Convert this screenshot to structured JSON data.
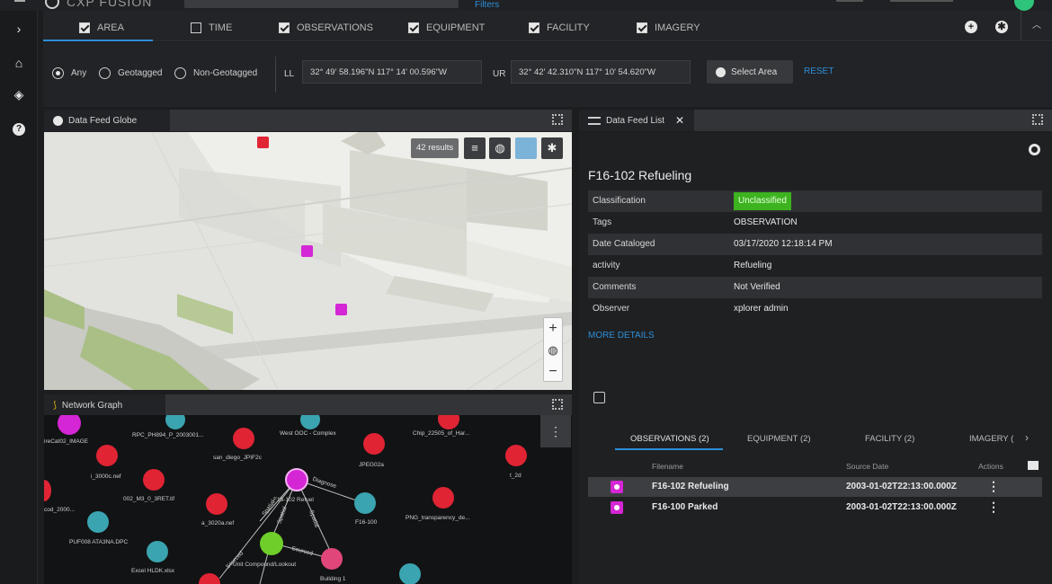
{
  "topbar": {
    "brand": "CXP FUSION",
    "filters_link": "Filters"
  },
  "rail": {
    "expand": "›",
    "home": "⌂",
    "layers": "◈",
    "help": "?"
  },
  "filter_tabs": [
    {
      "label": "AREA",
      "checked": true
    },
    {
      "label": "TIME",
      "checked": false
    },
    {
      "label": "OBSERVATIONS",
      "checked": true
    },
    {
      "label": "EQUIPMENT",
      "checked": true
    },
    {
      "label": "FACILITY",
      "checked": true
    },
    {
      "label": "IMAGERY",
      "checked": true
    }
  ],
  "area": {
    "options": [
      "Any",
      "Geotagged",
      "Non-Geotagged"
    ],
    "selected": "Any",
    "ll_label": "LL",
    "ll_value": "32° 49' 58.196\"N 117° 14' 00.596\"W",
    "ur_label": "UR",
    "ur_value": "32° 42' 42.310\"N 117° 10' 54.620\"W",
    "select_area": "Select Area",
    "reset": "RESET"
  },
  "globe_panel": {
    "title": "Data Feed Globe",
    "results": "42 results"
  },
  "graph_panel": {
    "title": "Network Graph",
    "nodes": [
      {
        "label": "ireCat02_IMAGE",
        "kind": "target",
        "color": "#d426d4"
      },
      {
        "label": "RPC_PH894_P_2003001...",
        "kind": "doc",
        "color": "#3aa4b0"
      },
      {
        "label": "West OOC - Complex",
        "kind": "doc",
        "color": "#3aa4b0"
      },
      {
        "label": "Chip_22505_of_Har...",
        "kind": "camera",
        "color": "#e02434"
      },
      {
        "label": "i_3000c.nef",
        "kind": "camera",
        "color": "#e02434"
      },
      {
        "label": "san_diego_JPIF2c",
        "kind": "camera",
        "color": "#e02434"
      },
      {
        "label": "JPEG02a",
        "kind": "camera",
        "color": "#e02434"
      },
      {
        "label": "t_2d",
        "kind": "camera",
        "color": "#e02434"
      },
      {
        "label": "002_M3_0_3RET.tif",
        "kind": "camera",
        "color": "#e02434"
      },
      {
        "label": "F16-102 Refuel",
        "kind": "target",
        "color": "#d426d4"
      },
      {
        "label": "a_3020a.nef",
        "kind": "camera",
        "color": "#e02434"
      },
      {
        "label": "F16-100",
        "kind": "plane",
        "color": "#3aa4b0"
      },
      {
        "label": "PNG_transparency_de...",
        "kind": "camera",
        "color": "#e02434"
      },
      {
        "label": "cod_2000...",
        "kind": "camera",
        "color": "#e02434"
      },
      {
        "label": "PUF008 ATA3NA.DPC",
        "kind": "doc",
        "color": "#3aa4b0"
      },
      {
        "label": "Excel HLDK.xlsx",
        "kind": "doc",
        "color": "#3aa4b0"
      },
      {
        "label": "Unit Compound/Lookout",
        "kind": "eye",
        "color": "#6fce2a"
      },
      {
        "label": "Building 1",
        "kind": "building",
        "color": "#e0467a"
      }
    ],
    "edges": [
      "Diagnose",
      "Spatial",
      "Spatial",
      "Spatial",
      "Sourced",
      "Sourced"
    ]
  },
  "list_panel": {
    "title": "Data Feed List",
    "record_title": "F16-102 Refueling",
    "attributes": [
      {
        "key": "Classification",
        "value": "Unclassified",
        "badge": true
      },
      {
        "key": "Tags",
        "value": "OBSERVATION"
      },
      {
        "key": "Date Cataloged",
        "value": "03/17/2020 12:18:14 PM"
      },
      {
        "key": "activity",
        "value": "Refueling"
      },
      {
        "key": "Comments",
        "value": "Not Verified"
      },
      {
        "key": "Observer",
        "value": "xplorer admin"
      }
    ],
    "more_details": "MORE DETAILS",
    "subtabs": [
      "OBSERVATIONS (2)",
      "EQUIPMENT (2)",
      "FACILITY (2)",
      "IMAGERY (",
      "›"
    ],
    "columns": {
      "filename": "Filename",
      "source_date": "Source Date",
      "actions": "Actions"
    },
    "rows": [
      {
        "filename": "F16-102 Refueling",
        "source_date": "2003-01-02T22:13:00.000Z",
        "actions": "⋮"
      },
      {
        "filename": "F16-100 Parked",
        "source_date": "2003-01-02T22:13:00.000Z",
        "actions": "⋮"
      }
    ]
  },
  "colors": {
    "accent": "#2d8fd8",
    "badge_green": "#3cb31f",
    "observation_magenta": "#d426d4",
    "camera_red": "#e02434"
  }
}
